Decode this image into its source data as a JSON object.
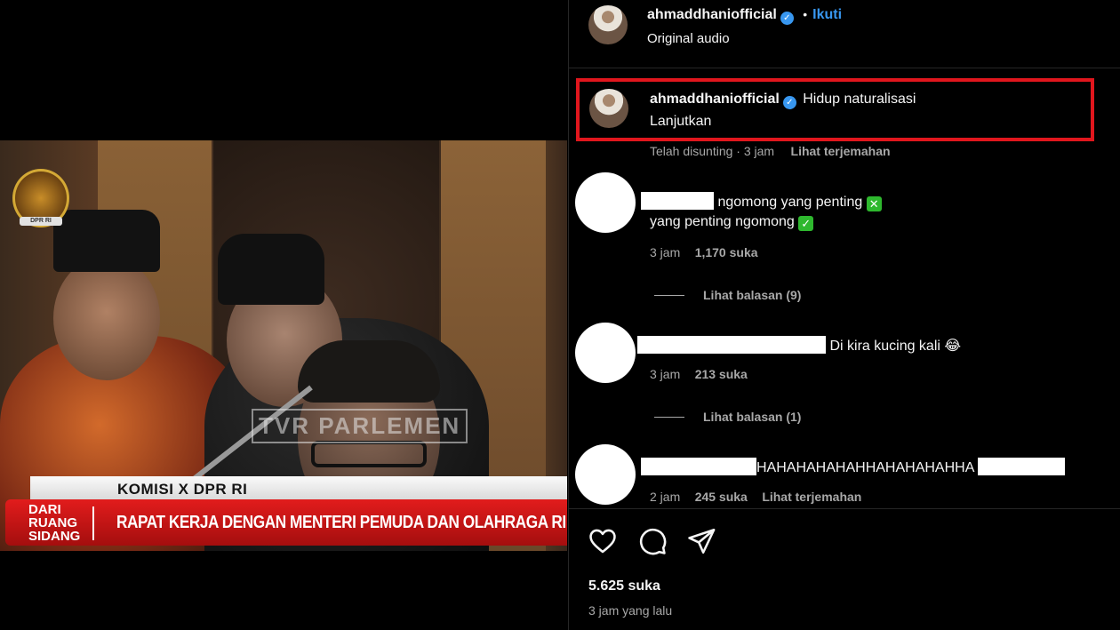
{
  "video": {
    "emblem_text": "DPR RI",
    "watermark": "TVR PARLEMEN",
    "lower_third_top": "KOMISI X DPR RI",
    "lower_third_tag": [
      "DARI",
      "RUANG",
      "SIDANG"
    ],
    "lower_third_title": "RAPAT KERJA DENGAN MENTERI PEMUDA DAN OLAHRAGA RI"
  },
  "post": {
    "header": {
      "username": "ahmaddhaniofficial",
      "separator": "•",
      "follow_label": "Ikuti",
      "audio_label": "Original audio"
    },
    "caption": {
      "username": "ahmaddhaniofficial",
      "text_line1": "Hidup naturalisasi",
      "text_line2": "Lanjutkan",
      "meta": "Telah disunting · 3 jam",
      "translate_label": "Lihat terjemahan"
    },
    "comments": [
      {
        "text_line1": "ngomong yang penting",
        "text_line2": "yang penting ngomong",
        "emoji1": "✕",
        "emoji2": "✓",
        "time": "3 jam",
        "likes": "1,170 suka",
        "replies_label": "Lihat balasan (9)"
      },
      {
        "text": "Di kira kucing kali",
        "emoji": "😂",
        "time": "3 jam",
        "likes": "213 suka",
        "replies_label": "Lihat balasan (1)"
      },
      {
        "text": "HAHAHAHAHAHHAHAHAHAHHA",
        "time": "2 jam",
        "likes": "245 suka",
        "translate_label": "Lihat terjemahan"
      }
    ],
    "actions": {
      "like_icon": "heart-icon",
      "comment_icon": "comment-bubble-icon",
      "share_icon": "send-icon"
    },
    "likes_total": "5.625 suka",
    "posted_time": "3 jam yang lalu",
    "colors": {
      "verified": "#3897f0",
      "follow": "#3897f0",
      "highlight": "#e1161d",
      "check_emoji": "#2eb82e"
    }
  }
}
